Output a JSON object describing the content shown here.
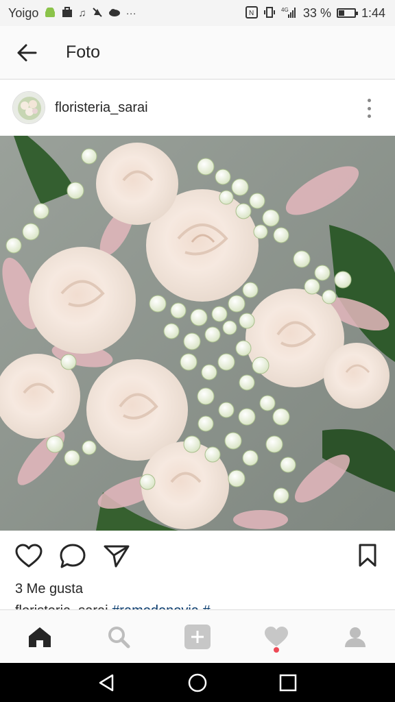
{
  "status_bar": {
    "carrier": "Yoigo",
    "battery_percent_text": "33 %",
    "battery_level": 0.33,
    "time": "1:44",
    "network": "4G",
    "left_icons": [
      "android-icon",
      "briefcase-icon",
      "music-note-icon",
      "mute-icon",
      "cloud-icon",
      "more-dots-icon"
    ],
    "right_icons": [
      "nfc-icon",
      "vibrate-icon",
      "signal-icon",
      "battery-icon"
    ]
  },
  "app_bar": {
    "title": "Foto",
    "back_icon": "arrow-left-icon"
  },
  "post": {
    "username": "floristeria_sarai",
    "likes_text": "3 Me gusta",
    "caption_user": "floristeria_sarai",
    "caption_tag": "#ramodenovia #"
  },
  "actions": {
    "icons": [
      "heart-outline-icon",
      "comment-icon",
      "share-icon",
      "bookmark-icon"
    ]
  },
  "bottom_nav": {
    "items": [
      "home-icon",
      "search-icon",
      "add-post-icon",
      "activity-heart-icon",
      "profile-icon"
    ],
    "active": "home-icon",
    "accent_color": "#ed4956"
  },
  "system_nav": {
    "items": [
      "back-triangle-icon",
      "home-circle-icon",
      "recents-square-icon"
    ]
  }
}
